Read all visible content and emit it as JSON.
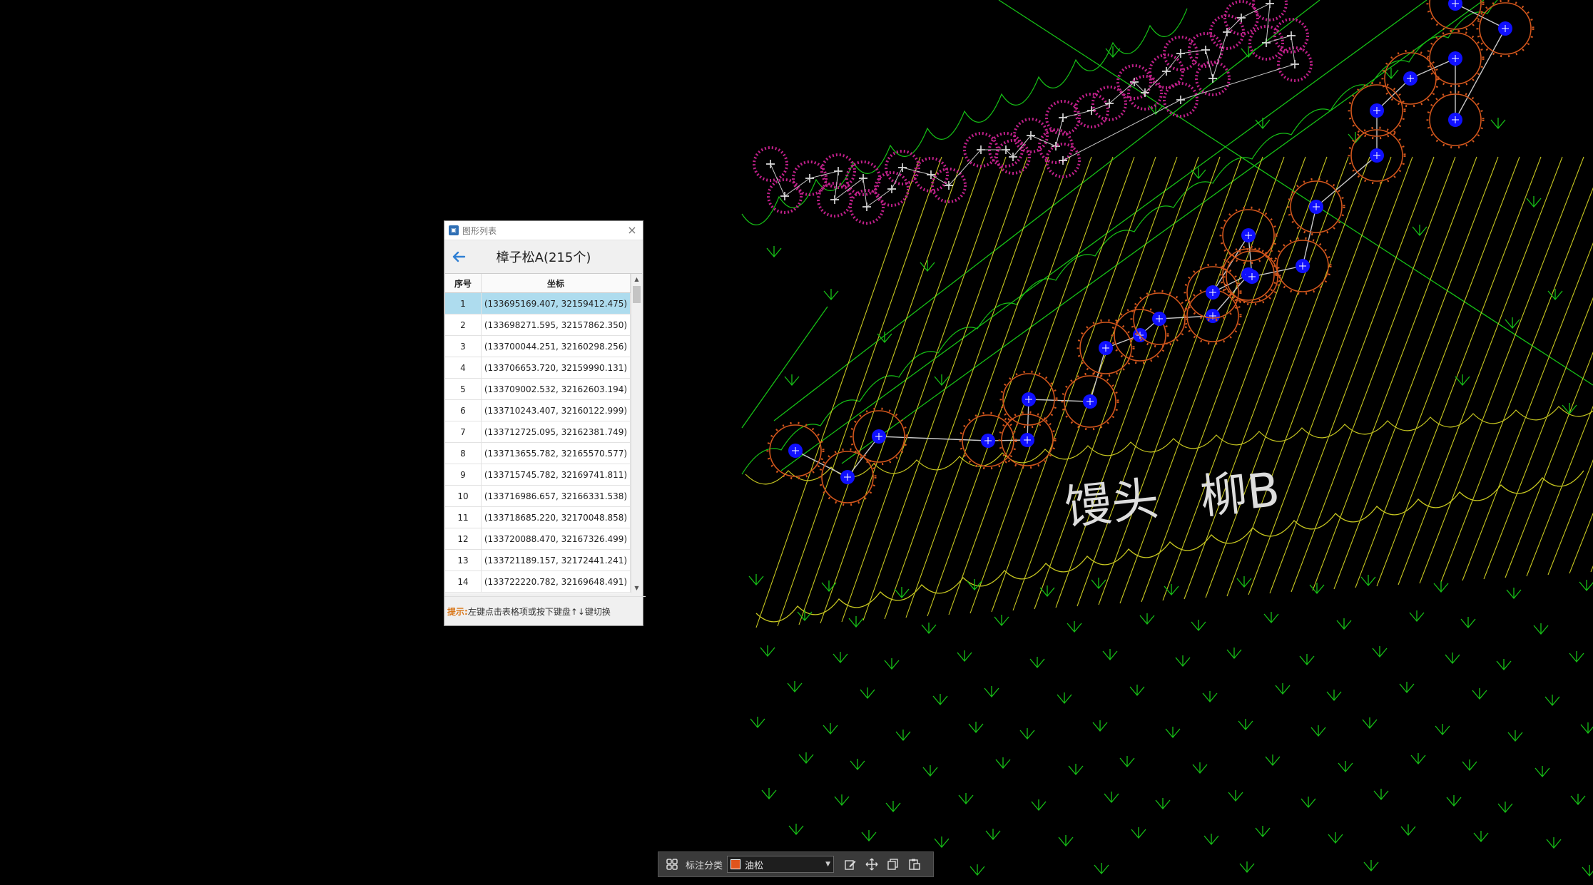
{
  "canvas": {
    "labels": [
      "馒头",
      "柳B"
    ],
    "colors": {
      "background": "#000000",
      "green_line": "#16c016",
      "yellow_line": "#c8c820",
      "orange_tree": "#d2561c",
      "magenta_tree": "#c0208a",
      "tree_center": "#1010ff",
      "link": "#c8c8c8",
      "label": "#dddddd"
    }
  },
  "panel": {
    "window_title": "图形列表",
    "heading": "樟子松A(215个)",
    "columns": [
      "序号",
      "坐标"
    ],
    "rows": [
      {
        "idx": "1",
        "coord": "(133695169.407, 32159412.475)"
      },
      {
        "idx": "2",
        "coord": "(133698271.595, 32157862.350)"
      },
      {
        "idx": "3",
        "coord": "(133700044.251, 32160298.256)"
      },
      {
        "idx": "4",
        "coord": "(133706653.720, 32159990.131)"
      },
      {
        "idx": "5",
        "coord": "(133709002.532, 32162603.194)"
      },
      {
        "idx": "6",
        "coord": "(133710243.407, 32160122.999)"
      },
      {
        "idx": "7",
        "coord": "(133712725.095, 32162381.749)"
      },
      {
        "idx": "8",
        "coord": "(133713655.782, 32165570.577)"
      },
      {
        "idx": "9",
        "coord": "(133715745.782, 32169741.811)"
      },
      {
        "idx": "10",
        "coord": "(133716986.657, 32166331.538)"
      },
      {
        "idx": "11",
        "coord": "(133718685.220, 32170048.858)"
      },
      {
        "idx": "12",
        "coord": "(133720088.470, 32167326.499)"
      },
      {
        "idx": "13",
        "coord": "(133721189.157, 32172441.241)"
      },
      {
        "idx": "14",
        "coord": "(133722220.782, 32169648.491)"
      }
    ],
    "selected_row": "1",
    "hint_label": "提示:",
    "hint_text": "左键点击表格项或按下键盘↑↓键切换"
  },
  "toolbar": {
    "category_label": "标注分类",
    "selected_category": "油松",
    "swatch_color": "#e0541c"
  }
}
